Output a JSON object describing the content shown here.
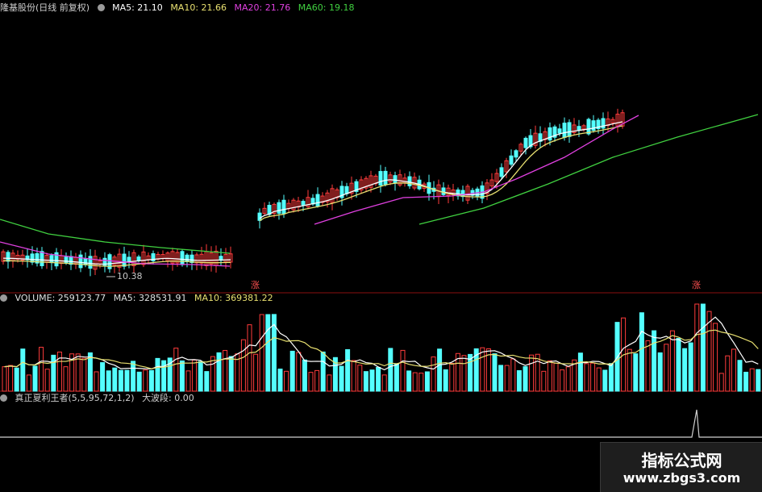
{
  "price_header": {
    "stock": "隆基股份(日线 前复权)",
    "ma5": "MA5: 21.10",
    "ma10": "MA10: 21.66",
    "ma20": "MA20: 21.76",
    "ma60": "MA60: 19.18"
  },
  "volume_header": {
    "volume": "VOLUME: 259123.77",
    "ma5": "MA5: 328531.91",
    "ma10": "MA10: 369381.22"
  },
  "indicator_header": {
    "name": "真正夏利王者(5,5,95,72,1,2)",
    "value": "大波段: 0.00"
  },
  "annotations": {
    "low_price": "10.38",
    "mark_left": "涨",
    "mark_right": "涨"
  },
  "watermark": {
    "line1": "指标公式网",
    "line2": "www.zbgs3.com"
  },
  "colors": {
    "background": "#000000",
    "up": "#ff3c3c",
    "down": "#54ffff",
    "ma5": "#ffffff",
    "ma10": "#e8e070",
    "ma20": "#e040e0",
    "ma60": "#40d040",
    "pane_border": "#8a1010"
  },
  "chart_data": [
    {
      "type": "candlestick",
      "title": "隆基股份(日线 前复权)",
      "series": [
        {
          "name": "MA5",
          "current": 21.1
        },
        {
          "name": "MA10",
          "current": 21.66
        },
        {
          "name": "MA20",
          "current": 21.76
        },
        {
          "name": "MA60",
          "current": 19.18
        }
      ],
      "annotations": [
        "10.38"
      ]
    },
    {
      "type": "bar",
      "title": "VOLUME",
      "series": [
        {
          "name": "VOLUME",
          "current": 259123.77
        },
        {
          "name": "MA5",
          "current": 328531.91
        },
        {
          "name": "MA10",
          "current": 369381.22
        }
      ]
    },
    {
      "type": "line",
      "title": "真正夏利王者(5,5,95,72,1,2)",
      "series": [
        {
          "name": "大波段",
          "current": 0.0
        }
      ]
    }
  ]
}
